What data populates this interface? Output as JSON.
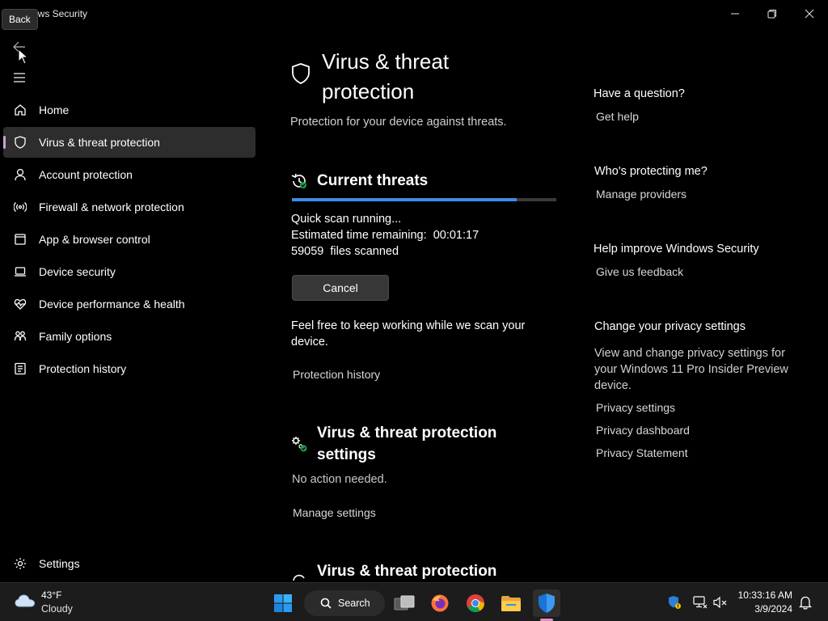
{
  "window": {
    "title": "Windows Security",
    "visible_title": "ows Security",
    "tooltip": "Back"
  },
  "sidebar": {
    "items": [
      {
        "label": "Home",
        "icon": "home-icon"
      },
      {
        "label": "Virus & threat protection",
        "icon": "shield-icon",
        "active": true
      },
      {
        "label": "Account protection",
        "icon": "person-icon"
      },
      {
        "label": "Firewall & network protection",
        "icon": "wireless-icon"
      },
      {
        "label": "App & browser control",
        "icon": "app-window-icon"
      },
      {
        "label": "Device security",
        "icon": "laptop-icon"
      },
      {
        "label": "Device performance & health",
        "icon": "heart-pulse-icon"
      },
      {
        "label": "Family options",
        "icon": "family-icon"
      },
      {
        "label": "Protection history",
        "icon": "history-icon"
      }
    ],
    "settings_label": "Settings",
    "accent_color": "#c8a2d8"
  },
  "main": {
    "title": "Virus & threat protection",
    "subtitle": "Protection for your device against threats.",
    "current_threats": {
      "heading": "Current threats",
      "progress": 0.85,
      "status": "Quick scan running...",
      "estimated_label": "Estimated time remaining:",
      "estimated_value": "00:01:17",
      "files_count": "59059",
      "files_label": "files scanned",
      "cancel_label": "Cancel",
      "note": "Feel free to keep working while we scan your device.",
      "history_link": "Protection history"
    },
    "settings_section": {
      "heading": "Virus & threat protection settings",
      "status": "No action needed.",
      "link": "Manage settings"
    },
    "updates_section": {
      "heading": "Virus & threat protection"
    }
  },
  "right_column": {
    "question": {
      "heading": "Have a question?",
      "link": "Get help"
    },
    "protecting": {
      "heading": "Who's protecting me?",
      "link": "Manage providers"
    },
    "improve": {
      "heading": "Help improve Windows Security",
      "link": "Give us feedback"
    },
    "privacy": {
      "heading": "Change your privacy settings",
      "text": "View and change privacy settings for your Windows 11 Pro Insider Preview device.",
      "links": [
        "Privacy settings",
        "Privacy dashboard",
        "Privacy Statement"
      ]
    }
  },
  "taskbar": {
    "weather_temp": "43°F",
    "weather_desc": "Cloudy",
    "search_label": "Search",
    "time": "10:33:16 AM",
    "date": "3/9/2024"
  }
}
